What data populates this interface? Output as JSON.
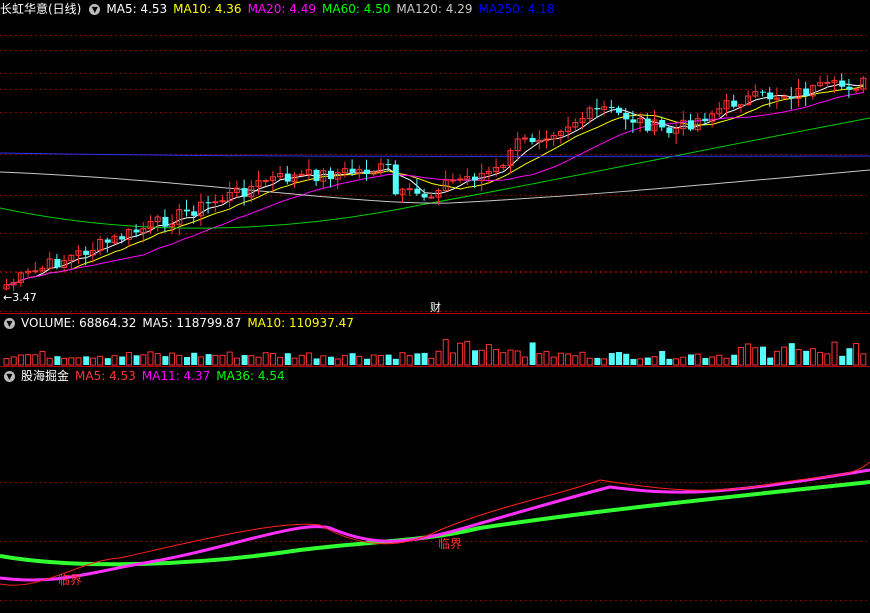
{
  "main_panel": {
    "stock_title": "长虹华意(日线)",
    "ma_labels": [
      {
        "text": "MA5: 4.53",
        "color": "#ffffff"
      },
      {
        "text": "MA10: 4.36",
        "color": "#ffff00"
      },
      {
        "text": "MA20: 4.49",
        "color": "#ff00ff"
      },
      {
        "text": "MA60: 4.50",
        "color": "#00ff00"
      },
      {
        "text": "MA120: 4.29",
        "color": "#c8c8c8"
      },
      {
        "text": "MA250: 4.18",
        "color": "#0000ff"
      }
    ],
    "low_price_marker": "←3.47",
    "finance_marker": "财"
  },
  "volume_panel": {
    "labels": [
      {
        "text": "VOLUME: 68864.32",
        "color": "#ffffff"
      },
      {
        "text": "MA5: 118799.87",
        "color": "#ffffff"
      },
      {
        "text": "MA10: 110937.47",
        "color": "#ffff00"
      }
    ]
  },
  "indicator_panel": {
    "name": "股海掘金",
    "labels": [
      {
        "text": "MA5: 4.53",
        "color": "#ff3333"
      },
      {
        "text": "MA11: 4.37",
        "color": "#ff00ff"
      },
      {
        "text": "MA36: 4.54",
        "color": "#00ff00"
      }
    ],
    "signal_text_1": "临界",
    "signal_text_2": "临界"
  },
  "colors": {
    "up": "#ff3232",
    "down": "#54fcfc",
    "grid": "#8b0000"
  },
  "icons": [
    "collapse-arrow-icon"
  ]
}
